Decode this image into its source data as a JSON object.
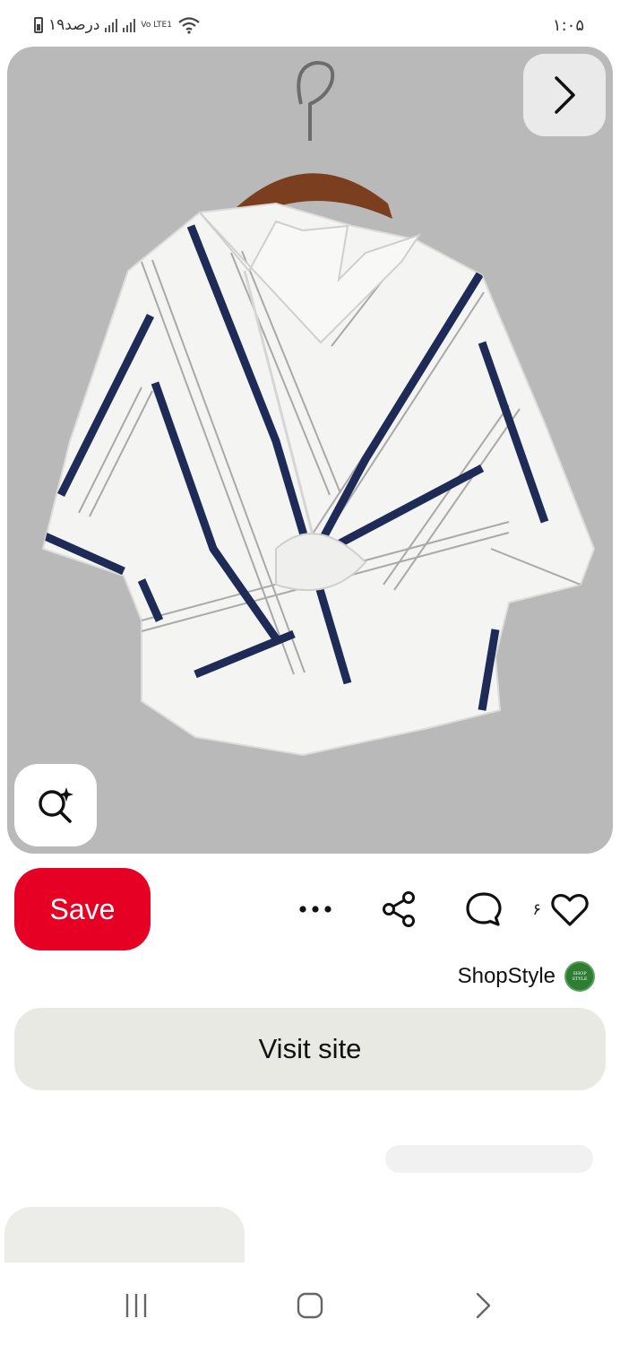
{
  "status_bar": {
    "time": "۱:۰۵",
    "battery_text": "۱۹درصد",
    "network_label": "Vo LTE1",
    "icons": [
      "battery-icon",
      "signal-icon",
      "signal-icon",
      "wifi-icon"
    ]
  },
  "product": {
    "image_description_icon": "striped-shirt-image",
    "next_icon": "chevron-right-icon",
    "lens_icon": "visual-search-icon"
  },
  "actions": {
    "save_label": "Save",
    "like_count": "۶",
    "icons": [
      "more-icon",
      "share-icon",
      "comment-icon",
      "heart-icon"
    ]
  },
  "source": {
    "name": "ShopStyle",
    "logo_text": "SHOP STYLE"
  },
  "visit_label": "Visit site",
  "colors": {
    "save": "#e60023",
    "image_bg": "#b9b9b9",
    "button_bg": "#e9e9e4",
    "stripe": "#1f2b57"
  }
}
